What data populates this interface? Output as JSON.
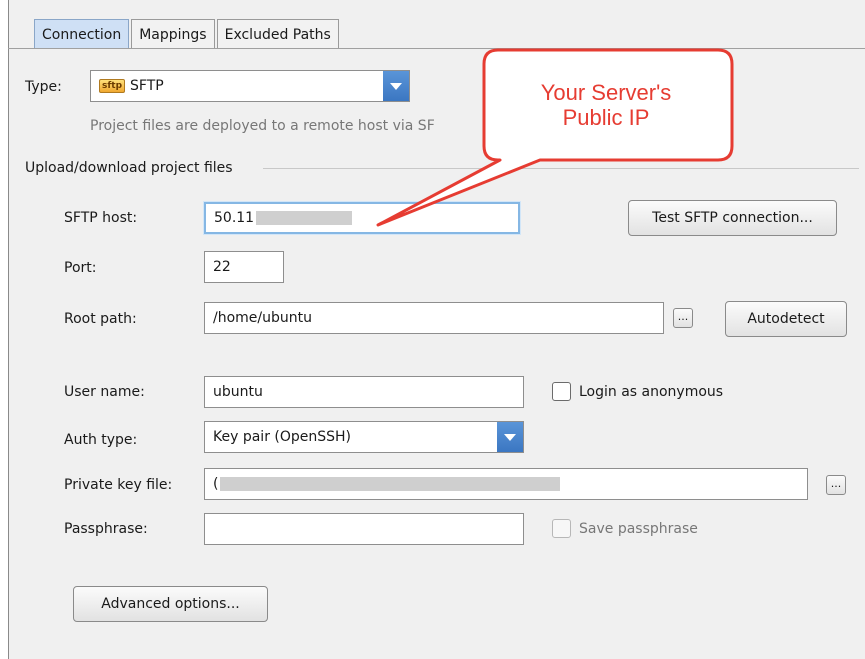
{
  "tabs": [
    {
      "label": "Connection",
      "active": true
    },
    {
      "label": "Mappings",
      "active": false
    },
    {
      "label": "Excluded Paths",
      "active": false
    }
  ],
  "type": {
    "label": "Type:",
    "icon_text": "sftp",
    "value": "SFTP",
    "description": "Project files are deployed to a remote host via SF"
  },
  "section_upload": "Upload/download project files",
  "sftp_host": {
    "label": "SFTP host:",
    "value": "50.11"
  },
  "test_button": "Test SFTP connection...",
  "port": {
    "label": "Port:",
    "value": "22"
  },
  "root_path": {
    "label": "Root path:",
    "value": "/home/ubuntu",
    "browse": "...",
    "autodetect": "Autodetect"
  },
  "user_name": {
    "label": "User name:",
    "value": "ubuntu"
  },
  "login_anonymous": {
    "label": "Login as anonymous",
    "checked": false
  },
  "auth_type": {
    "label": "Auth type:",
    "value": "Key pair (OpenSSH)"
  },
  "private_key": {
    "label": "Private key file:",
    "value": "(",
    "browse": "..."
  },
  "passphrase": {
    "label": "Passphrase:",
    "value": ""
  },
  "save_passphrase": {
    "label": "Save passphrase",
    "checked": false,
    "enabled": false
  },
  "advanced_button": "Advanced options...",
  "callout": {
    "line1": "Your Server's",
    "line2": "Public IP",
    "color": "#e63c32"
  },
  "colors": {
    "accent": "#3b77c2",
    "focus": "#85b7e4",
    "tab_active": "#cfe0f5"
  }
}
